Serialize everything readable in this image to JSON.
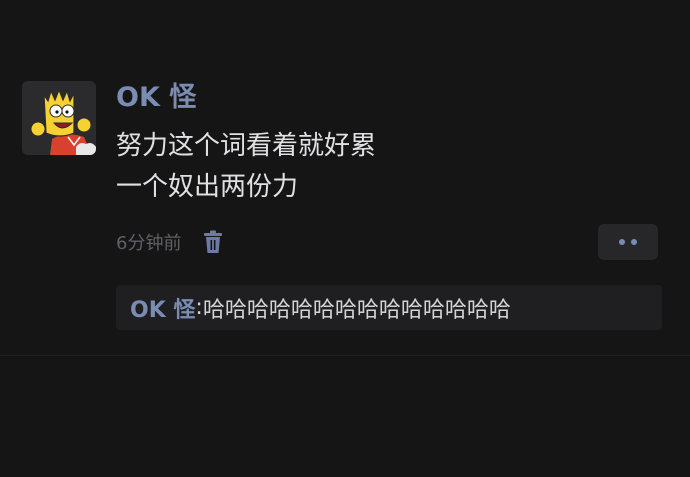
{
  "post": {
    "username": "OK 怪",
    "content_lines": [
      "努力这个词看着就好累",
      "一个奴出两份力"
    ],
    "time": "6分钟前",
    "avatar_icon": "cartoon-boy-avatar",
    "delete_icon": "trash-icon",
    "more_icon": "more-dots-icon"
  },
  "comments": [
    {
      "author": "OK 怪",
      "separator": ": ",
      "text": "哈哈哈哈哈哈哈哈哈哈哈哈哈哈"
    }
  ],
  "colors": {
    "background": "#151516",
    "name_accent": "#7b8cb3",
    "text_primary": "#e1e1e3",
    "text_secondary": "#5f6066",
    "comment_panel": "#1f1f21"
  }
}
